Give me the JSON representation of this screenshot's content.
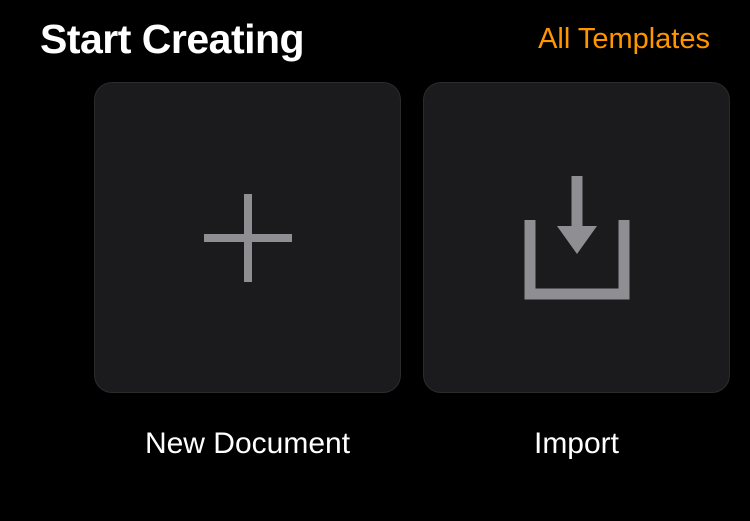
{
  "header": {
    "title": "Start Creating",
    "templates_link": "All Templates"
  },
  "cards": {
    "new_document": {
      "label": "New Document",
      "icon": "plus-icon"
    },
    "import": {
      "label": "Import",
      "icon": "import-icon"
    }
  },
  "colors": {
    "accent": "#ff9500",
    "icon": "#8e8e93",
    "card_bg": "#1b1b1d"
  }
}
